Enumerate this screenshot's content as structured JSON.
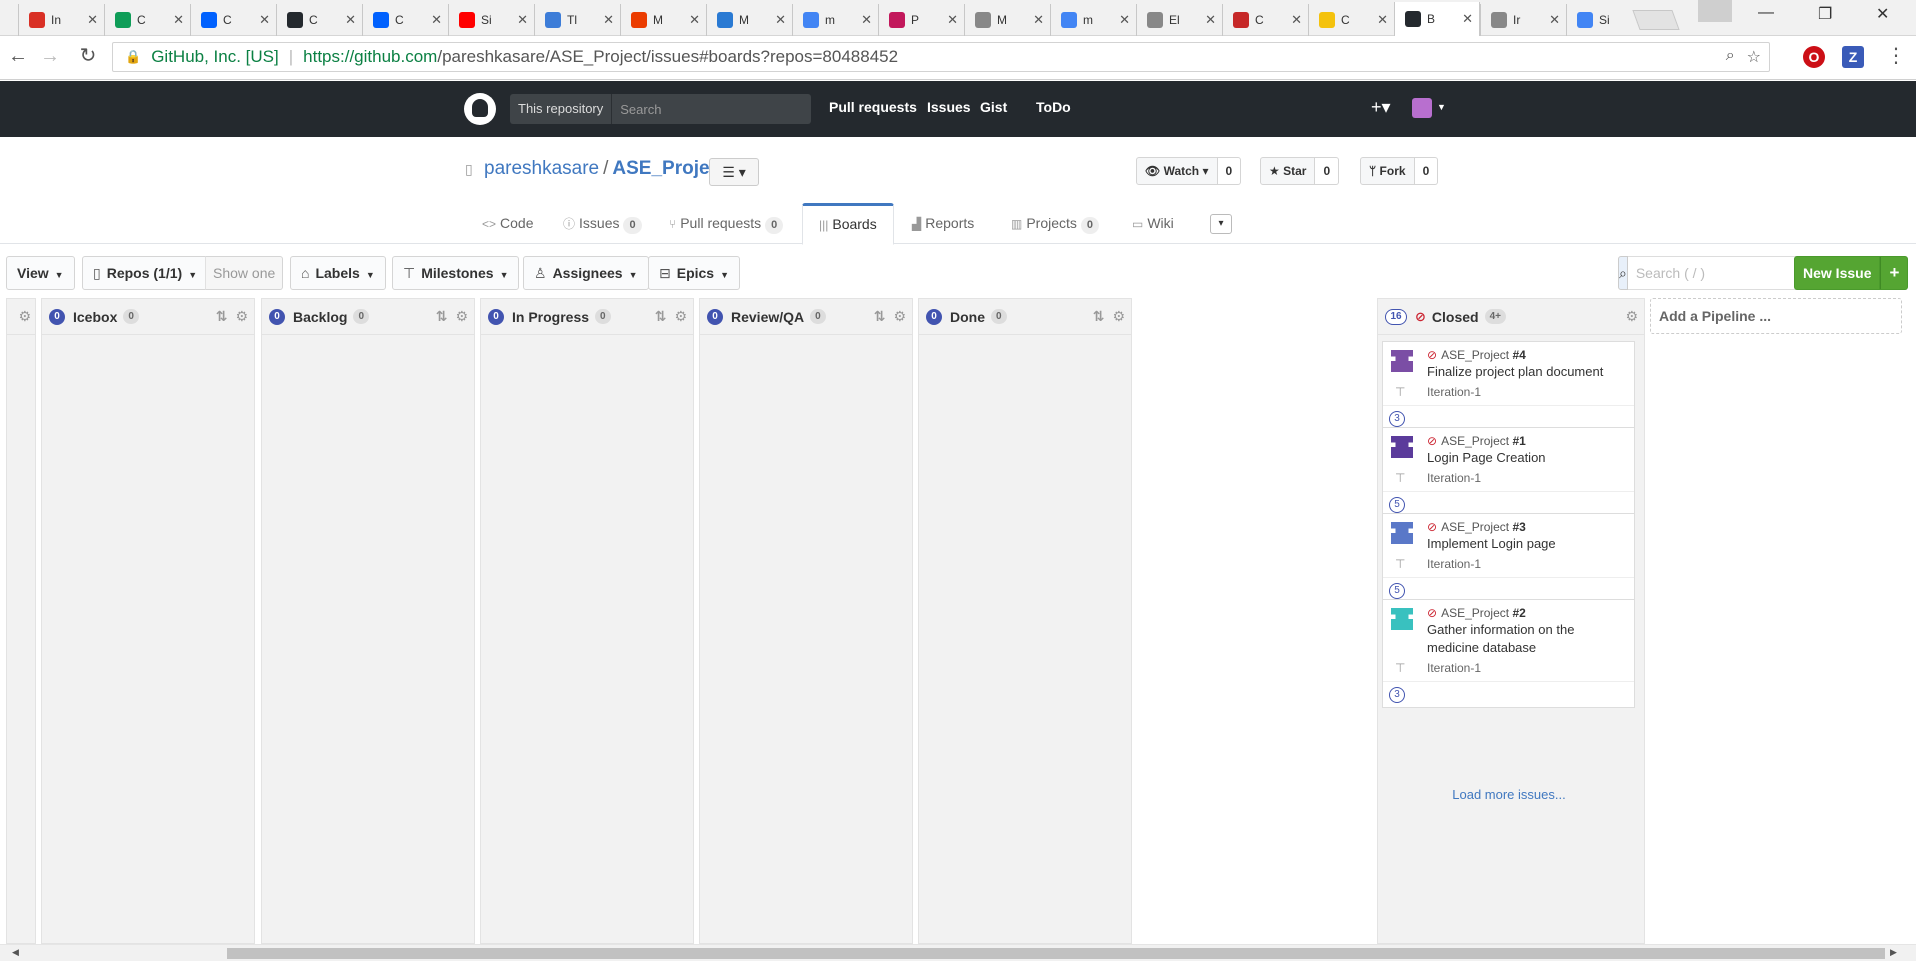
{
  "browser": {
    "tabs": [
      {
        "label": "In",
        "favicon_color": "#d93025"
      },
      {
        "label": "C",
        "favicon_color": "#0f9d58"
      },
      {
        "label": "C",
        "favicon_color": "#0061fe"
      },
      {
        "label": "C",
        "favicon_color": "#24292e"
      },
      {
        "label": "C",
        "favicon_color": "#0061fe"
      },
      {
        "label": "Si",
        "favicon_color": "#ff0000"
      },
      {
        "label": "Tl",
        "favicon_color": "#3d7dd8"
      },
      {
        "label": "M",
        "favicon_color": "#eb3c00"
      },
      {
        "label": "M",
        "favicon_color": "#2a7ad3"
      },
      {
        "label": "m",
        "favicon_color": "#4285f4"
      },
      {
        "label": "P",
        "favicon_color": "#c2185b"
      },
      {
        "label": "M",
        "favicon_color": "#888888"
      },
      {
        "label": "m",
        "favicon_color": "#4285f4"
      },
      {
        "label": "El",
        "favicon_color": "#888888"
      },
      {
        "label": "C",
        "favicon_color": "#c62828"
      },
      {
        "label": "C",
        "favicon_color": "#f4c20d"
      },
      {
        "label": "B",
        "favicon_color": "#24292e",
        "active": true
      },
      {
        "label": "Ir",
        "favicon_color": "#888888"
      },
      {
        "label": "Si",
        "favicon_color": "#4285f4"
      }
    ],
    "close_glyph": "✕",
    "window": {
      "minimize": "—",
      "restore": "❐",
      "close": "✕"
    },
    "address": {
      "ev_label": "GitHub, Inc. [US]",
      "url_host": "https://github.com",
      "url_path": "/pareshkasare/ASE_Project/issues#boards?repos=80488452"
    },
    "extensions": [
      {
        "label": "O",
        "color": "#cc0f16"
      },
      {
        "label": "Z",
        "color": "#3a5bb8"
      }
    ]
  },
  "github_header": {
    "scope_label": "This repository",
    "search_placeholder": "Search",
    "nav": [
      "Pull requests",
      "Issues",
      "Gist",
      "ToDo"
    ],
    "plus_label": "+▾"
  },
  "repo": {
    "owner": "pareshkasare",
    "separator": "/",
    "name": "ASE_Project",
    "list_button": "☰ ▾",
    "watch": {
      "label": "Watch ▾",
      "count": "0"
    },
    "star": {
      "label": "Star",
      "count": "0"
    },
    "fork": {
      "label": "Fork",
      "count": "0"
    }
  },
  "reponav": {
    "code": {
      "label": "Code"
    },
    "issues": {
      "label": "Issues",
      "count": "0"
    },
    "pulls": {
      "label": "Pull requests",
      "count": "0"
    },
    "boards": {
      "label": "Boards"
    },
    "reports": {
      "label": "Reports"
    },
    "projects": {
      "label": "Projects",
      "count": "0"
    },
    "wiki": {
      "label": "Wiki"
    },
    "more": "▾"
  },
  "filters": {
    "view": "View",
    "repos": "Repos (1/1)",
    "show_one": "Show one",
    "labels": "Labels",
    "milestones": "Milestones",
    "assignees": "Assignees",
    "epics": "Epics",
    "search_placeholder": "Search ( / )",
    "new_issue": "New Issue",
    "new_issue_plus": "+"
  },
  "board": {
    "pipelines": [
      {
        "name": "Icebox",
        "count": "0",
        "badge": "0"
      },
      {
        "name": "Backlog",
        "count": "0",
        "badge": "0"
      },
      {
        "name": "In Progress",
        "count": "0",
        "badge": "0"
      },
      {
        "name": "Review/QA",
        "count": "0",
        "badge": "0"
      },
      {
        "name": "Done",
        "count": "0",
        "badge": "0"
      }
    ],
    "closed": {
      "name": "Closed",
      "count": "16",
      "badge": "4+",
      "issues": [
        {
          "repo": "ASE_Project",
          "number": "#4",
          "title": "Finalize project plan document",
          "milestone": "Iteration-1",
          "estimate": "3",
          "avatar_color": "#7b4ea5"
        },
        {
          "repo": "ASE_Project",
          "number": "#1",
          "title": "Login Page Creation",
          "milestone": "Iteration-1",
          "estimate": "5",
          "avatar_color": "#5b3b9b"
        },
        {
          "repo": "ASE_Project",
          "number": "#3",
          "title": "Implement Login page",
          "milestone": "Iteration-1",
          "estimate": "5",
          "avatar_color": "#5a78c8"
        },
        {
          "repo": "ASE_Project",
          "number": "#2",
          "title": "Gather information on the medicine database",
          "milestone": "Iteration-1",
          "estimate": "3",
          "avatar_color": "#39c1bf"
        }
      ],
      "load_more": "Load more issues..."
    },
    "add_pipeline": "Add a Pipeline ..."
  }
}
